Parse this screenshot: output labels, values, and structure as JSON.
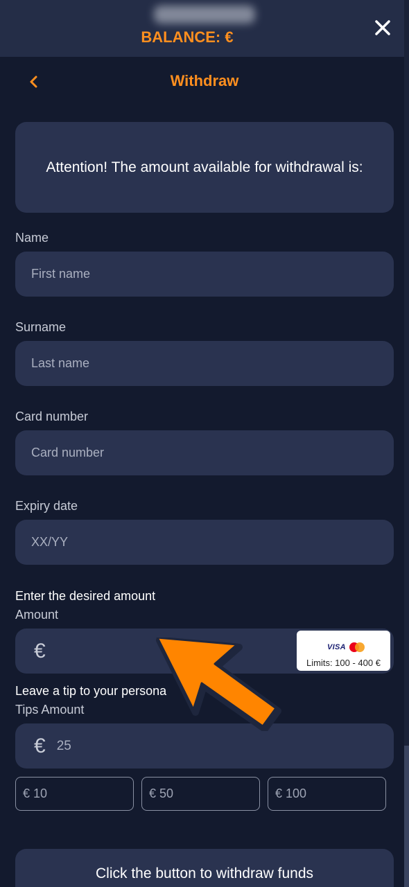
{
  "header": {
    "balance_label": "BALANCE: €",
    "close_icon": "close-icon"
  },
  "page": {
    "title": "Withdraw",
    "back_icon": "chevron-left-icon"
  },
  "attention": {
    "text": "Attention! The amount available for withdrawal is:"
  },
  "form": {
    "name": {
      "label": "Name",
      "placeholder": "First name"
    },
    "surname": {
      "label": "Surname",
      "placeholder": "Last name"
    },
    "card_number": {
      "label": "Card number",
      "placeholder": "Card number"
    },
    "expiry": {
      "label": "Expiry date",
      "placeholder": "XX/YY"
    },
    "amount": {
      "heading": "Enter the desired amount",
      "label": "Amount",
      "currency": "€",
      "card_logos": [
        "VISA",
        "mastercard"
      ],
      "limits": "Limits: 100 - 400 €"
    },
    "tips": {
      "heading": "Leave a tip to your persona",
      "label": "Tips Amount",
      "currency": "€",
      "value": "25",
      "presets": [
        "€ 10",
        "€ 50",
        "€ 100"
      ]
    }
  },
  "withdraw_button": {
    "label": "Click the button to withdraw funds"
  },
  "colors": {
    "accent": "#ff8f1f",
    "background": "#131a2e",
    "header": "#242d47",
    "field": "#2a3350"
  }
}
